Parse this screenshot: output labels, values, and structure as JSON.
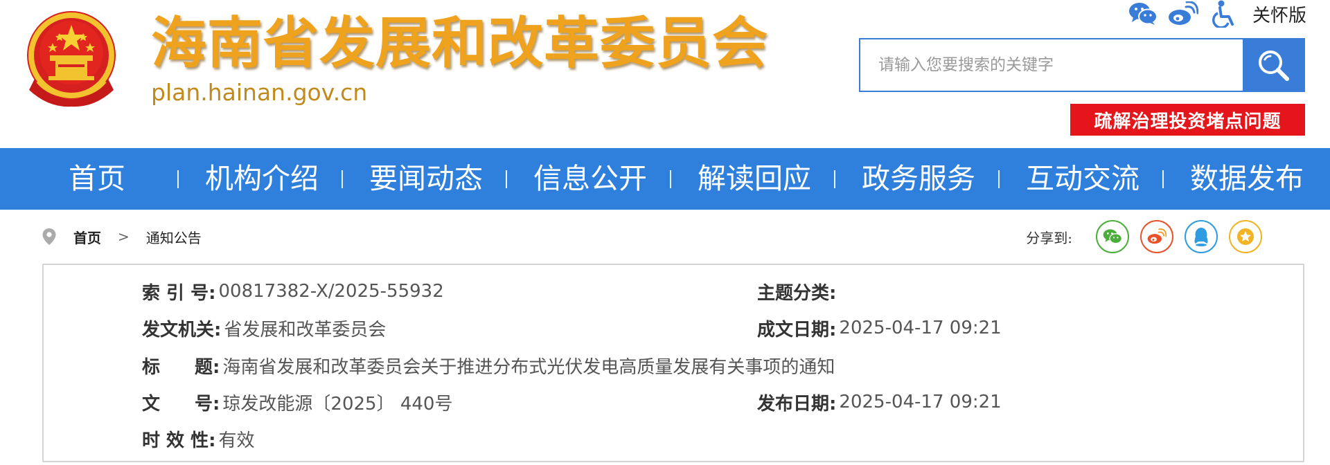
{
  "header": {
    "site_title": "海南省发展和改革委员会",
    "site_domain": "plan.hainan.gov.cn",
    "utilities": {
      "icons": [
        "wechat-icon",
        "weibo-icon",
        "accessibility-icon"
      ],
      "care_label": "关怀版"
    },
    "search": {
      "placeholder": "请输入您要搜索的关键字",
      "value": ""
    },
    "banner_label": "疏解治理投资堵点问题",
    "colors": {
      "title": "#efa21d",
      "primary_blue": "#2f80dd",
      "banner_red": "#e5161b"
    }
  },
  "nav": {
    "items": [
      "首页",
      "机构介绍",
      "要闻动态",
      "信息公开",
      "解读回应",
      "政务服务",
      "互动交流",
      "数据发布"
    ]
  },
  "breadcrumb": {
    "home": "首页",
    "separator": ">",
    "current": "通知公告"
  },
  "share": {
    "label": "分享到:",
    "targets": [
      "wechat-icon",
      "weibo-icon",
      "qq-icon",
      "favorite-icon"
    ]
  },
  "document_info": {
    "index_label": "索 引 号:",
    "index_value": "00817382-X/2025-55932",
    "topic_label": "主题分类:",
    "topic_value": "",
    "issuer_label": "发文机关:",
    "issuer_value": "省发展和改革委员会",
    "created_label": "成文日期:",
    "created_value": "2025-04-17 09:21",
    "title_label_a": "标",
    "title_label_b": "题:",
    "title_value": "海南省发展和改革委员会关于推进分布式光伏发电高质量发展有关事项的通知",
    "docno_label_a": "文",
    "docno_label_b": "号:",
    "docno_value": "琼发改能源〔2025〕 440号",
    "published_label": "发布日期:",
    "published_value": "2025-04-17 09:21",
    "validity_label": "时 效 性:",
    "validity_value": "有效"
  }
}
